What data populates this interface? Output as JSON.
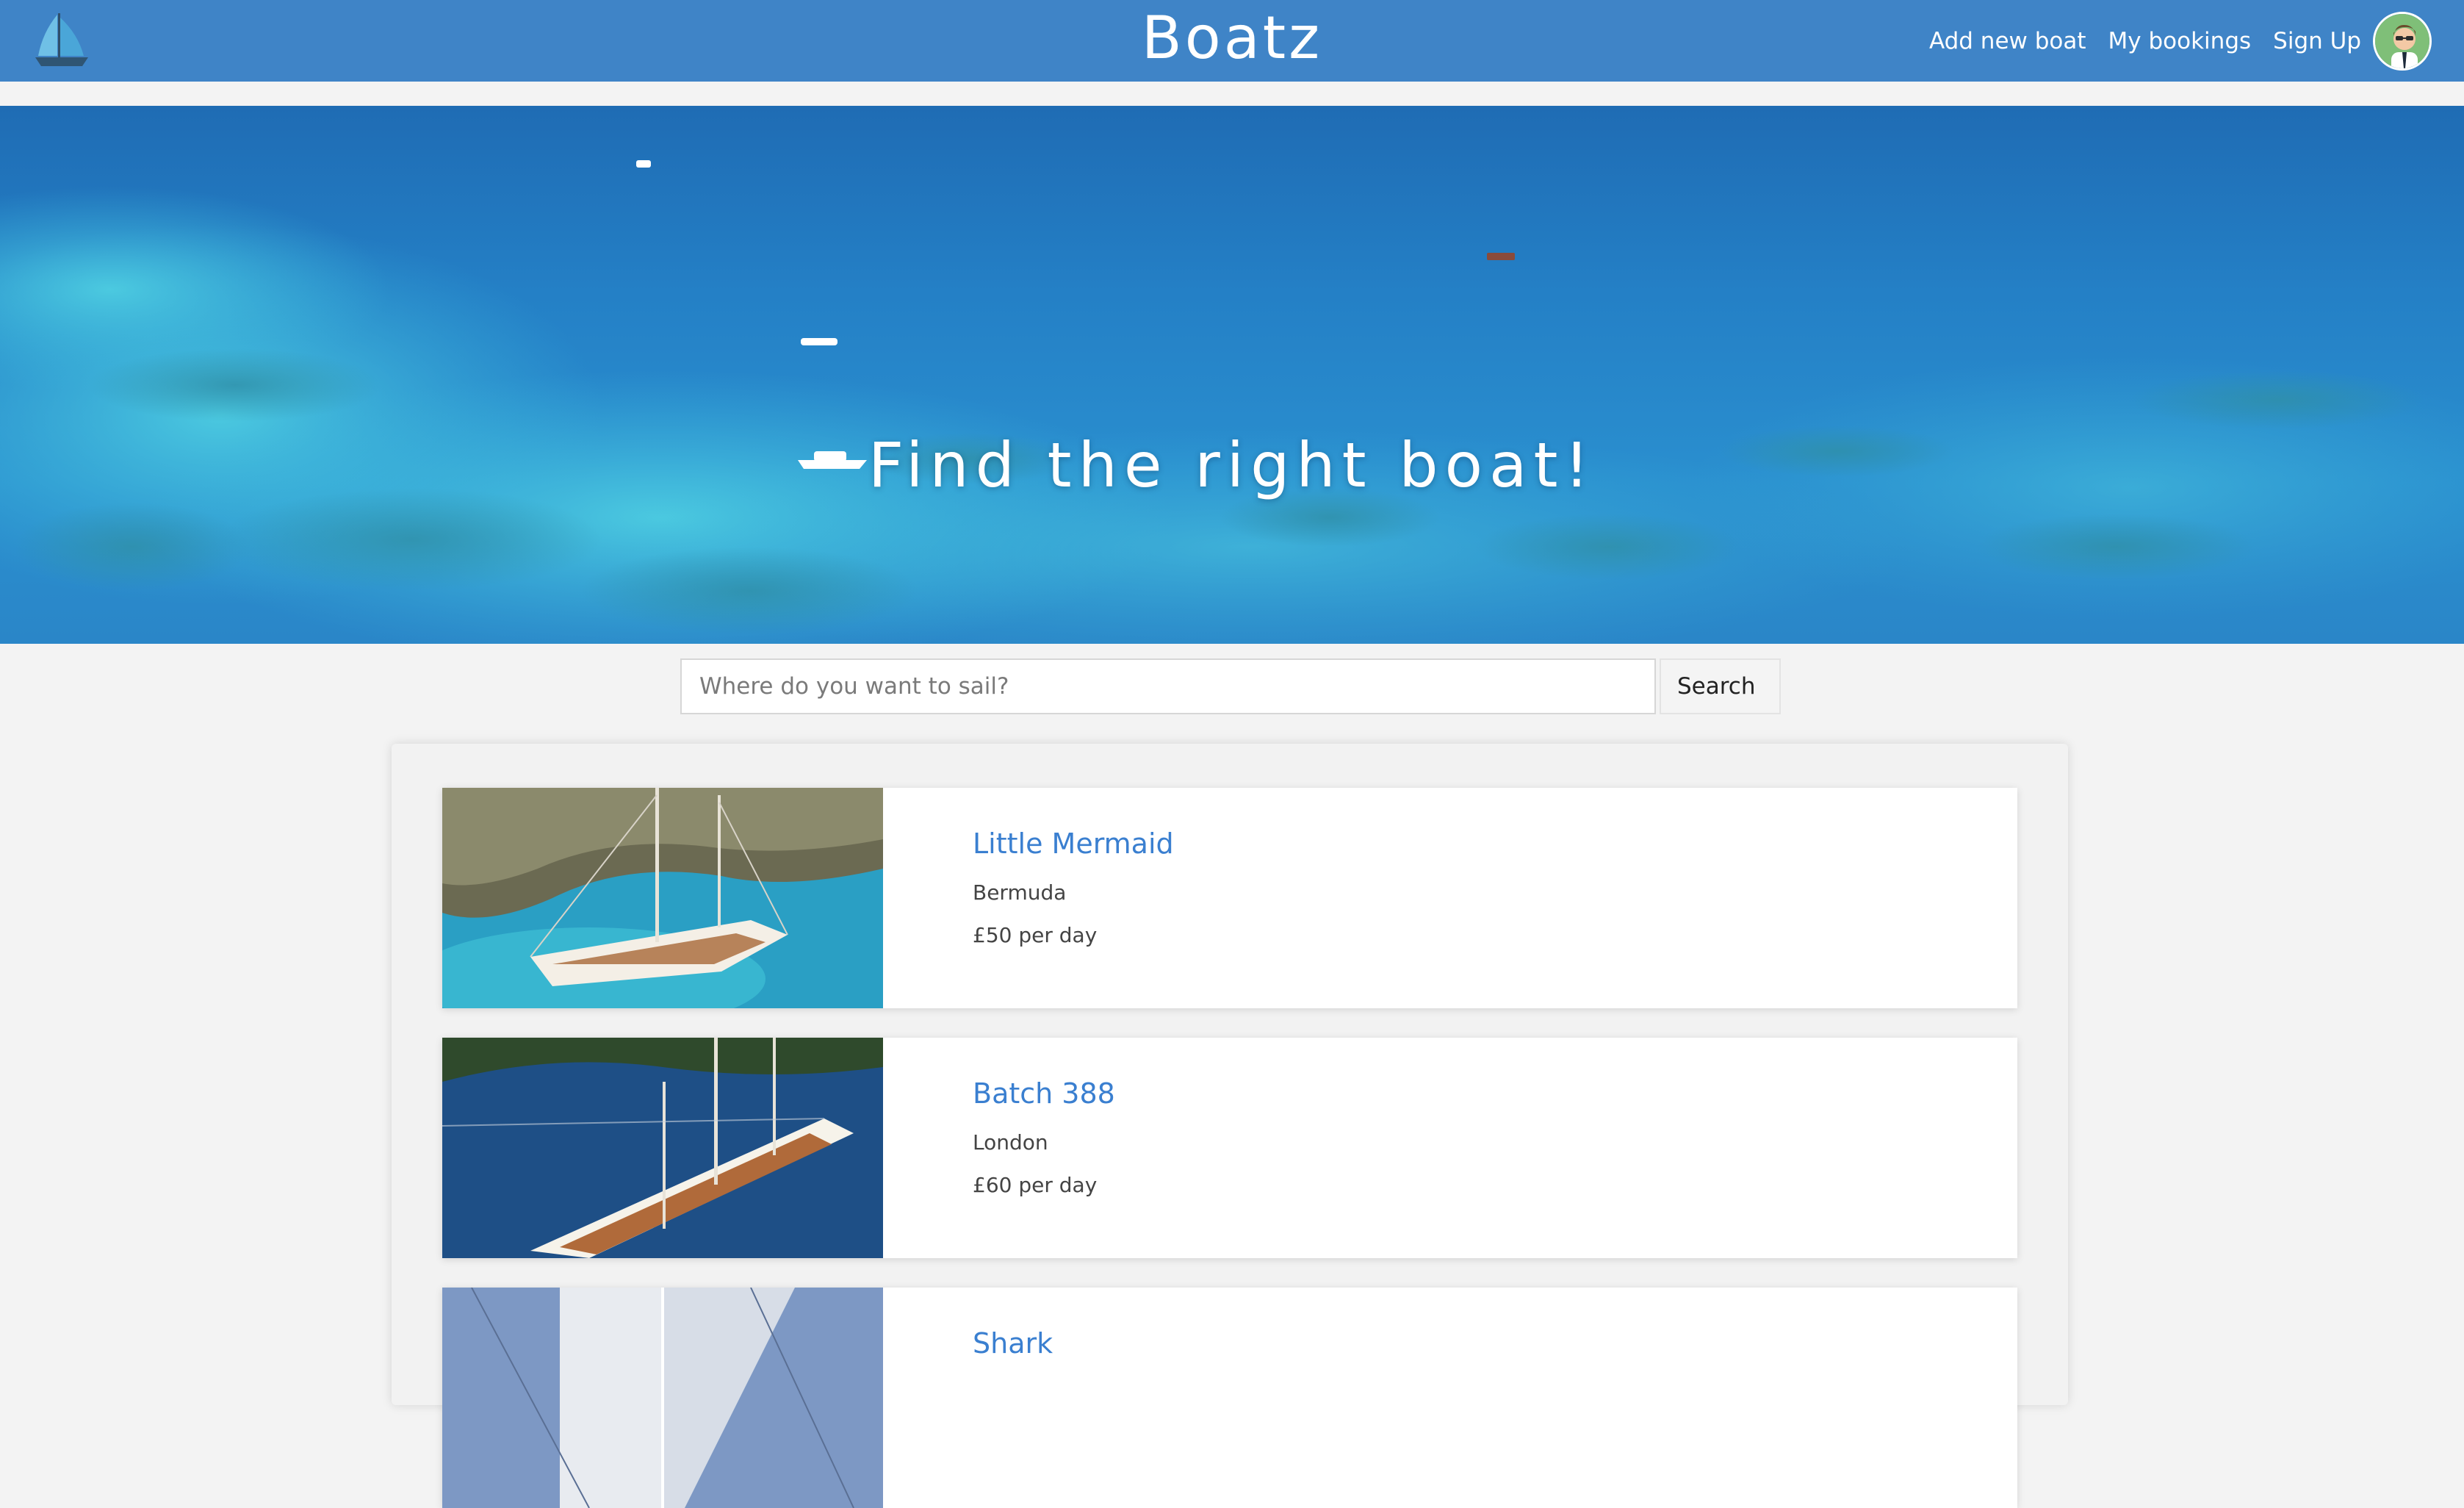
{
  "header": {
    "brand": "Boatz",
    "nav": {
      "add_boat": "Add new boat",
      "bookings": "My bookings",
      "signup": "Sign Up"
    },
    "colors": {
      "bar": "#3f84c7",
      "link": "#3a7fd0"
    },
    "icons": {
      "logo": "sailboat-icon",
      "avatar": "user-avatar"
    }
  },
  "hero": {
    "title": "Find the right boat!"
  },
  "search": {
    "placeholder": "Where do you want to sail?",
    "button": "Search"
  },
  "boats": [
    {
      "name": "Little Mermaid",
      "location": "Bermuda",
      "price": "£50 per day"
    },
    {
      "name": "Batch 388",
      "location": "London",
      "price": "£60 per day"
    },
    {
      "name": "Shark",
      "location": "",
      "price": ""
    }
  ]
}
